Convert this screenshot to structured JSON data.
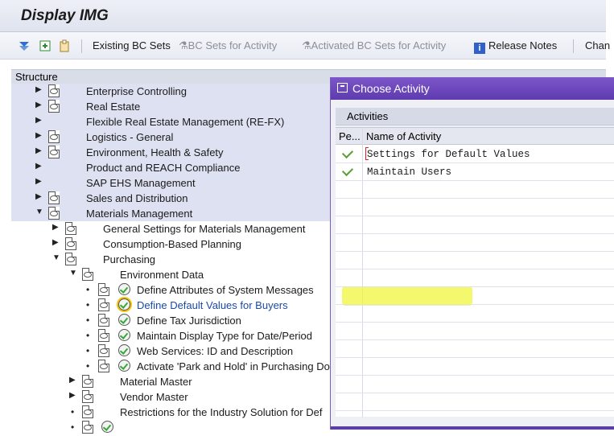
{
  "window": {
    "title": "Display IMG"
  },
  "toolbar": {
    "existing_bc_sets": "Existing BC Sets",
    "bc_sets_for_activity": "BC Sets for Activity",
    "activated_bc_sets": "Activated BC Sets for Activity",
    "release_notes": "Release Notes",
    "truncated": "Chan"
  },
  "structure": {
    "header": "Structure",
    "rows": [
      {
        "label": "Enterprise Controlling"
      },
      {
        "label": "Real Estate"
      },
      {
        "label": "Flexible Real Estate Management (RE-FX)"
      },
      {
        "label": "Logistics - General"
      },
      {
        "label": "Environment, Health & Safety"
      },
      {
        "label": "Product and REACH Compliance"
      },
      {
        "label": "SAP EHS Management"
      },
      {
        "label": "Sales and Distribution"
      },
      {
        "label": "Materials Management"
      },
      {
        "label": "General Settings for Materials Management"
      },
      {
        "label": "Consumption-Based Planning"
      },
      {
        "label": "Purchasing"
      },
      {
        "label": "Environment Data"
      },
      {
        "label": "Define Attributes of System Messages"
      },
      {
        "label": "Define Default Values for Buyers"
      },
      {
        "label": "Define Tax Jurisdiction"
      },
      {
        "label": "Maintain Display Type for Date/Period"
      },
      {
        "label": "Web Services: ID and Description"
      },
      {
        "label": "Activate 'Park and Hold' in Purchasing Do"
      },
      {
        "label": "Material Master"
      },
      {
        "label": "Vendor Master"
      },
      {
        "label": "Restrictions for the Industry Solution for Def"
      }
    ]
  },
  "dialog": {
    "title": "Choose Activity",
    "section": "Activities",
    "columns": {
      "perf": "Pe...",
      "name": "Name of Activity"
    },
    "activities": [
      {
        "name": "Settings for Default Values"
      },
      {
        "name": "Maintain Users"
      }
    ]
  }
}
